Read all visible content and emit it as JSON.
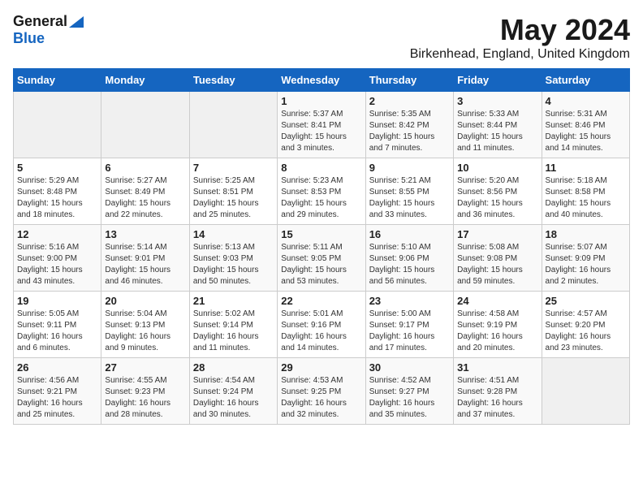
{
  "logo": {
    "general": "General",
    "blue": "Blue"
  },
  "title": "May 2024",
  "location": "Birkenhead, England, United Kingdom",
  "days_of_week": [
    "Sunday",
    "Monday",
    "Tuesday",
    "Wednesday",
    "Thursday",
    "Friday",
    "Saturday"
  ],
  "weeks": [
    [
      {
        "day": "",
        "info": ""
      },
      {
        "day": "",
        "info": ""
      },
      {
        "day": "",
        "info": ""
      },
      {
        "day": "1",
        "info": "Sunrise: 5:37 AM\nSunset: 8:41 PM\nDaylight: 15 hours\nand 3 minutes."
      },
      {
        "day": "2",
        "info": "Sunrise: 5:35 AM\nSunset: 8:42 PM\nDaylight: 15 hours\nand 7 minutes."
      },
      {
        "day": "3",
        "info": "Sunrise: 5:33 AM\nSunset: 8:44 PM\nDaylight: 15 hours\nand 11 minutes."
      },
      {
        "day": "4",
        "info": "Sunrise: 5:31 AM\nSunset: 8:46 PM\nDaylight: 15 hours\nand 14 minutes."
      }
    ],
    [
      {
        "day": "5",
        "info": "Sunrise: 5:29 AM\nSunset: 8:48 PM\nDaylight: 15 hours\nand 18 minutes."
      },
      {
        "day": "6",
        "info": "Sunrise: 5:27 AM\nSunset: 8:49 PM\nDaylight: 15 hours\nand 22 minutes."
      },
      {
        "day": "7",
        "info": "Sunrise: 5:25 AM\nSunset: 8:51 PM\nDaylight: 15 hours\nand 25 minutes."
      },
      {
        "day": "8",
        "info": "Sunrise: 5:23 AM\nSunset: 8:53 PM\nDaylight: 15 hours\nand 29 minutes."
      },
      {
        "day": "9",
        "info": "Sunrise: 5:21 AM\nSunset: 8:55 PM\nDaylight: 15 hours\nand 33 minutes."
      },
      {
        "day": "10",
        "info": "Sunrise: 5:20 AM\nSunset: 8:56 PM\nDaylight: 15 hours\nand 36 minutes."
      },
      {
        "day": "11",
        "info": "Sunrise: 5:18 AM\nSunset: 8:58 PM\nDaylight: 15 hours\nand 40 minutes."
      }
    ],
    [
      {
        "day": "12",
        "info": "Sunrise: 5:16 AM\nSunset: 9:00 PM\nDaylight: 15 hours\nand 43 minutes."
      },
      {
        "day": "13",
        "info": "Sunrise: 5:14 AM\nSunset: 9:01 PM\nDaylight: 15 hours\nand 46 minutes."
      },
      {
        "day": "14",
        "info": "Sunrise: 5:13 AM\nSunset: 9:03 PM\nDaylight: 15 hours\nand 50 minutes."
      },
      {
        "day": "15",
        "info": "Sunrise: 5:11 AM\nSunset: 9:05 PM\nDaylight: 15 hours\nand 53 minutes."
      },
      {
        "day": "16",
        "info": "Sunrise: 5:10 AM\nSunset: 9:06 PM\nDaylight: 15 hours\nand 56 minutes."
      },
      {
        "day": "17",
        "info": "Sunrise: 5:08 AM\nSunset: 9:08 PM\nDaylight: 15 hours\nand 59 minutes."
      },
      {
        "day": "18",
        "info": "Sunrise: 5:07 AM\nSunset: 9:09 PM\nDaylight: 16 hours\nand 2 minutes."
      }
    ],
    [
      {
        "day": "19",
        "info": "Sunrise: 5:05 AM\nSunset: 9:11 PM\nDaylight: 16 hours\nand 6 minutes."
      },
      {
        "day": "20",
        "info": "Sunrise: 5:04 AM\nSunset: 9:13 PM\nDaylight: 16 hours\nand 9 minutes."
      },
      {
        "day": "21",
        "info": "Sunrise: 5:02 AM\nSunset: 9:14 PM\nDaylight: 16 hours\nand 11 minutes."
      },
      {
        "day": "22",
        "info": "Sunrise: 5:01 AM\nSunset: 9:16 PM\nDaylight: 16 hours\nand 14 minutes."
      },
      {
        "day": "23",
        "info": "Sunrise: 5:00 AM\nSunset: 9:17 PM\nDaylight: 16 hours\nand 17 minutes."
      },
      {
        "day": "24",
        "info": "Sunrise: 4:58 AM\nSunset: 9:19 PM\nDaylight: 16 hours\nand 20 minutes."
      },
      {
        "day": "25",
        "info": "Sunrise: 4:57 AM\nSunset: 9:20 PM\nDaylight: 16 hours\nand 23 minutes."
      }
    ],
    [
      {
        "day": "26",
        "info": "Sunrise: 4:56 AM\nSunset: 9:21 PM\nDaylight: 16 hours\nand 25 minutes."
      },
      {
        "day": "27",
        "info": "Sunrise: 4:55 AM\nSunset: 9:23 PM\nDaylight: 16 hours\nand 28 minutes."
      },
      {
        "day": "28",
        "info": "Sunrise: 4:54 AM\nSunset: 9:24 PM\nDaylight: 16 hours\nand 30 minutes."
      },
      {
        "day": "29",
        "info": "Sunrise: 4:53 AM\nSunset: 9:25 PM\nDaylight: 16 hours\nand 32 minutes."
      },
      {
        "day": "30",
        "info": "Sunrise: 4:52 AM\nSunset: 9:27 PM\nDaylight: 16 hours\nand 35 minutes."
      },
      {
        "day": "31",
        "info": "Sunrise: 4:51 AM\nSunset: 9:28 PM\nDaylight: 16 hours\nand 37 minutes."
      },
      {
        "day": "",
        "info": ""
      }
    ]
  ]
}
